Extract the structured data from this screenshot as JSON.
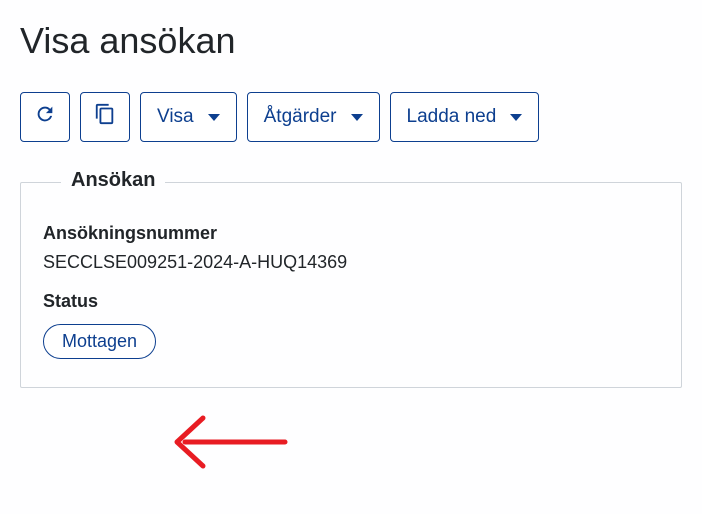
{
  "page": {
    "title": "Visa ansökan"
  },
  "toolbar": {
    "visa_label": "Visa",
    "actions_label": "Åtgärder",
    "download_label": "Ladda ned"
  },
  "panel": {
    "legend": "Ansökan",
    "application_number_label": "Ansökningsnummer",
    "application_number_value": "SECCLSE009251-2024-A-HUQ14369",
    "status_label": "Status",
    "status_value": "Mottagen"
  },
  "icons": {
    "refresh": "refresh-icon",
    "copy": "copy-icon",
    "caret": "chevron-down-icon"
  },
  "colors": {
    "primary": "#0d3f8f",
    "annotation": "#e81c23"
  }
}
